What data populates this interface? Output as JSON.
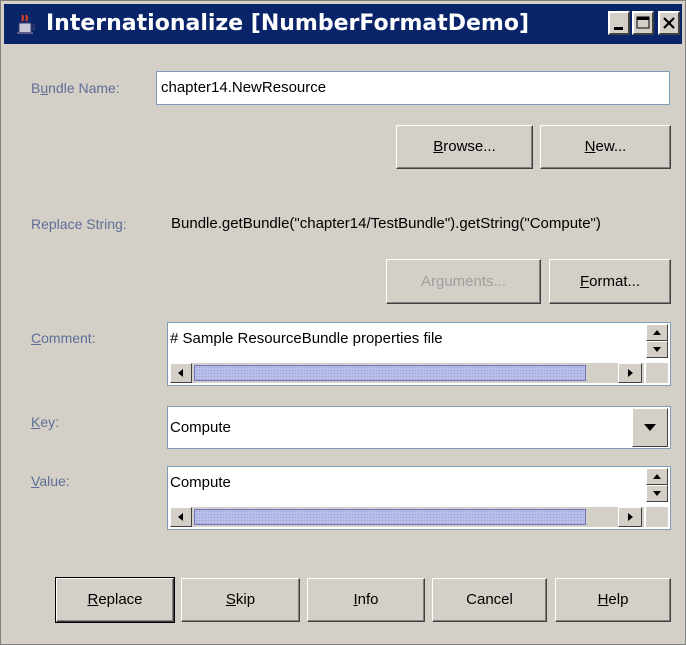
{
  "window": {
    "title": "Internationalize [NumberFormatDemo]",
    "minimize_icon": "minimize-icon",
    "maximize_icon": "maximize-icon",
    "close_icon": "close-icon",
    "app_icon": "java-cup-icon"
  },
  "form": {
    "bundle_name": {
      "label_pre": "B",
      "label_u": "u",
      "label_post": "ndle Name:",
      "value": "chapter14.NewResource"
    },
    "browse_button": {
      "u": "B",
      "rest": "rowse..."
    },
    "new_button": {
      "u": "N",
      "rest": "ew..."
    },
    "replace_string": {
      "label": "Replace String:",
      "value": "Bundle.getBundle(\"chapter14/TestBundle\").getString(\"Compute\")"
    },
    "arguments_button": {
      "pre": "Ar",
      "u": "g",
      "rest": "uments..."
    },
    "format_button": {
      "u": "F",
      "rest": "ormat..."
    },
    "comment": {
      "label_u": "C",
      "label_post": "omment:",
      "value": "# Sample ResourceBundle properties file"
    },
    "key": {
      "label_u": "K",
      "label_post": "ey:",
      "value": "Compute"
    },
    "value": {
      "label_u": "V",
      "label_post": "alue:",
      "value": "Compute"
    }
  },
  "footer": {
    "replace": {
      "u": "R",
      "rest": "eplace"
    },
    "skip": {
      "u": "S",
      "rest": "kip"
    },
    "info": {
      "u": "I",
      "rest": "nfo"
    },
    "cancel": {
      "label": "Cancel"
    },
    "help": {
      "u": "H",
      "rest": "elp"
    }
  },
  "colors": {
    "titlebar": "#0a246a",
    "label_text": "#5f6e96",
    "window_bg": "#d4d0c8",
    "thumb": "#b8bce8"
  }
}
